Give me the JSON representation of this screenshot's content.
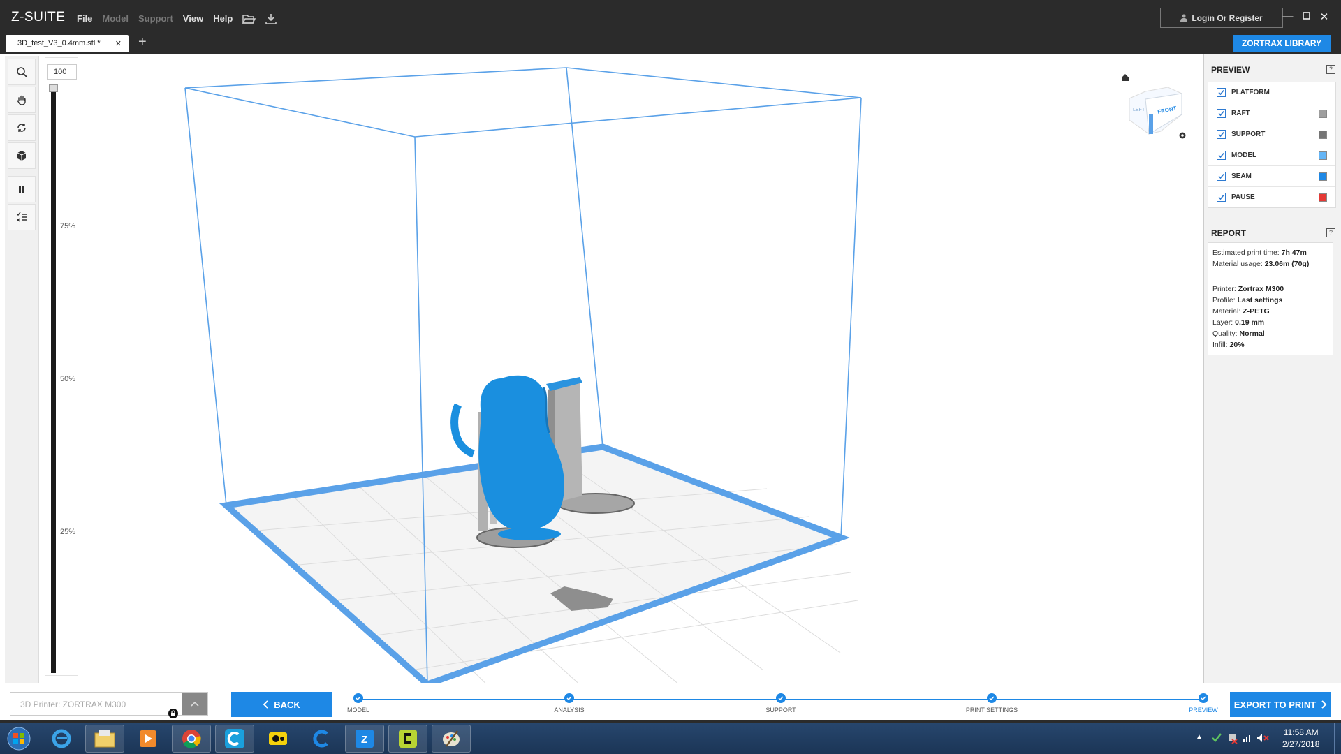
{
  "app": {
    "logo": "Z-SUITE"
  },
  "menu": [
    {
      "label": "File",
      "enabled": true
    },
    {
      "label": "Model",
      "enabled": false
    },
    {
      "label": "Support",
      "enabled": false
    },
    {
      "label": "View",
      "enabled": true
    },
    {
      "label": "Help",
      "enabled": true
    }
  ],
  "toolbar_icons": [
    "folder-open-icon",
    "download-icon"
  ],
  "account": {
    "login_label": "Login Or Register"
  },
  "window_controls": [
    "minimize",
    "maximize",
    "close"
  ],
  "tabs": [
    {
      "label": "3D_test_V3_0.4mm.stl *",
      "active": true
    }
  ],
  "zortrax_library": "ZORTRAX LIBRARY",
  "left_tools": [
    "search-icon",
    "hand-icon",
    "rotate-icon",
    "cube-icon",
    "pause-icon",
    "list-icon"
  ],
  "layer_slider": {
    "value": "100",
    "ticks": [
      "75%",
      "50%",
      "25%"
    ],
    "fraction": 1.0
  },
  "view_cube": {
    "faces": [
      "LEFT",
      "FRONT"
    ]
  },
  "preview": {
    "title": "PREVIEW",
    "help": "?",
    "items": [
      {
        "label": "PLATFORM",
        "checked": true,
        "color": null
      },
      {
        "label": "RAFT",
        "checked": true,
        "color": "#9e9e9e"
      },
      {
        "label": "SUPPORT",
        "checked": true,
        "color": "#757575"
      },
      {
        "label": "MODEL",
        "checked": true,
        "color": "#64b5f6"
      },
      {
        "label": "SEAM",
        "checked": true,
        "color": "#1e88e5"
      },
      {
        "label": "PAUSE",
        "checked": true,
        "color": "#e53935"
      }
    ]
  },
  "report": {
    "title": "REPORT",
    "help": "?",
    "print_time_label": "Estimated print time:",
    "print_time": "7h 47m",
    "material_label": "Material usage:",
    "material": "23.06m (70g)",
    "printer_label": "Printer:",
    "printer": "Zortrax M300",
    "profile_label": "Profile:",
    "profile": "Last settings",
    "material_type_label": "Material:",
    "material_type": "Z-PETG",
    "layer_label": "Layer:",
    "layer": "0.19 mm",
    "quality_label": "Quality:",
    "quality": "Normal",
    "infill_label": "Infill:",
    "infill": "20%"
  },
  "bottom": {
    "printer_select": "3D Printer: ZORTRAX M300",
    "back_label": "BACK",
    "export_label": "EXPORT TO PRINT",
    "steps": [
      {
        "label": "MODEL",
        "done": true
      },
      {
        "label": "ANALYSIS",
        "done": true
      },
      {
        "label": "SUPPORT",
        "done": true
      },
      {
        "label": "PRINT SETTINGS",
        "done": true
      },
      {
        "label": "PREVIEW",
        "done": true,
        "active": true
      }
    ]
  },
  "taskbar": {
    "apps": [
      "start-orb",
      "internet-explorer-icon",
      "file-explorer-icon",
      "media-player-icon",
      "chrome-icon",
      "app-c-icon",
      "app-yellow-icon",
      "app-c2-icon",
      "z-suite-icon",
      "app-c3-icon",
      "paint-icon"
    ],
    "time": "11:58 AM",
    "date": "2/27/2018"
  },
  "colors": {
    "accent": "#1e88e5",
    "model": "#1a8fdf",
    "support": "#9e9e9e",
    "titlebar": "#2b2b2b"
  }
}
